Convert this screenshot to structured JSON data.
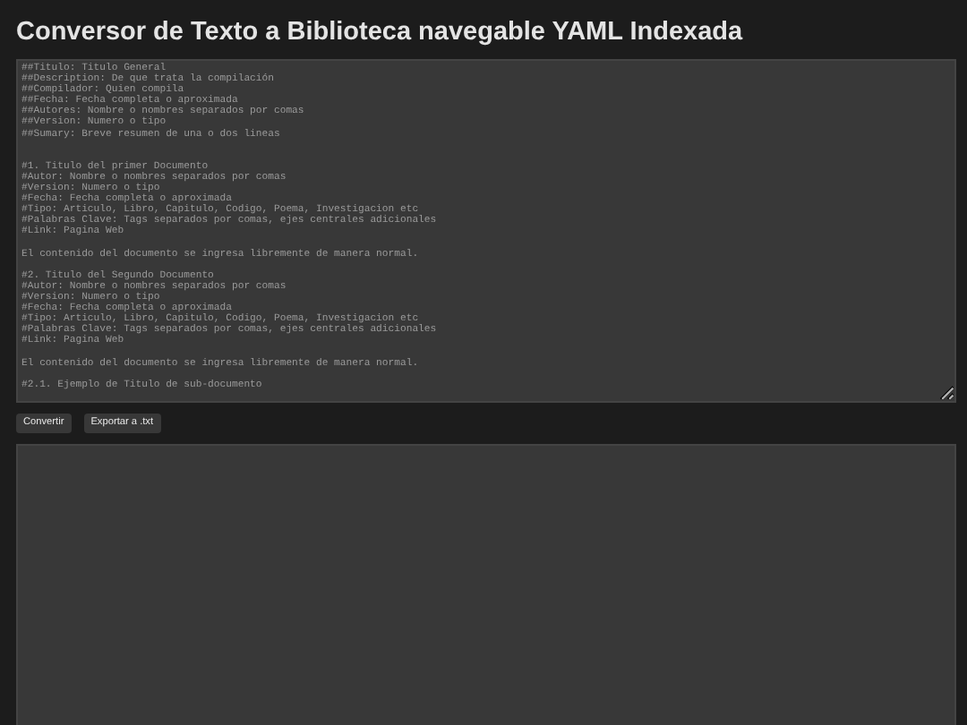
{
  "title": "Conversor de Texto a Biblioteca navegable YAML Indexada",
  "input": {
    "placeholder": "##Titulo: Titulo General\n##Description: De que trata la compilación\n##Compilador: Quien compila\n##Fecha: Fecha completa o aproximada\n##Autores: Nombre o nombres separados por comas\n##Version: Numero o tipo\n##Sumary: Breve resumen de una o dos lineas\n\n\n#1. Titulo del primer Documento\n#Autor: Nombre o nombres separados por comas\n#Version: Numero o tipo\n#Fecha: Fecha completa o aproximada\n#Tipo: Articulo, Libro, Capitulo, Codigo, Poema, Investigacion etc\n#Palabras Clave: Tags separados por comas, ejes centrales adicionales\n#Link: Pagina Web\n\nEl contenido del documento se ingresa libremente de manera normal.\n\n#2. Titulo del Segundo Documento\n#Autor: Nombre o nombres separados por comas\n#Version: Numero o tipo\n#Fecha: Fecha completa o aproximada\n#Tipo: Articulo, Libro, Capitulo, Codigo, Poema, Investigacion etc\n#Palabras Clave: Tags separados por comas, ejes centrales adicionales\n#Link: Pagina Web\n\nEl contenido del documento se ingresa libremente de manera normal.\n\n#2.1. Ejemplo de Titulo de sub-documento"
  },
  "buttons": [
    "Convertir",
    "Exportar a .txt"
  ]
}
